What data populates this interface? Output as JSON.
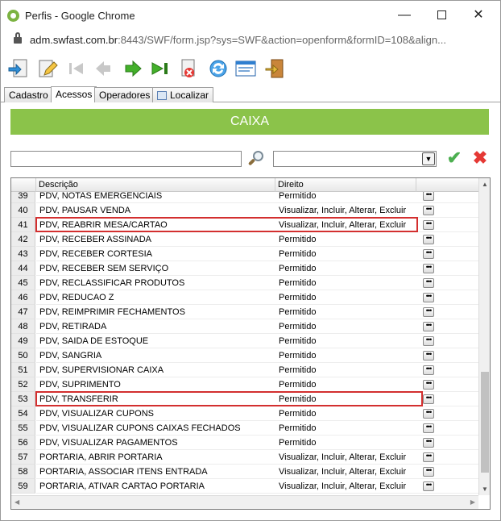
{
  "window": {
    "title": "Perfis - Google Chrome",
    "minimize": "—",
    "close": "✕"
  },
  "address": {
    "host": "adm.swfast.com.br",
    "rest": ":8443/SWF/form.jsp?sys=SWF&action=openform&formID=108&align..."
  },
  "tabs": [
    {
      "label": "Cadastro"
    },
    {
      "label": "Acessos"
    },
    {
      "label": "Operadores"
    },
    {
      "label": "Localizar"
    }
  ],
  "header": {
    "title": "CAIXA"
  },
  "filter": {
    "value": "",
    "select_value": ""
  },
  "grid": {
    "columns": {
      "descricao": "Descrição",
      "direito": "Direito"
    },
    "rows": [
      {
        "n": "39",
        "desc": "PDV, NOTAS EMERGENCIAIS",
        "dir": "Permitido"
      },
      {
        "n": "40",
        "desc": "PDV, PAUSAR VENDA",
        "dir": "Visualizar, Incluir, Alterar, Excluir"
      },
      {
        "n": "41",
        "desc": "PDV, REABRIR MESA/CARTAO",
        "dir": "Visualizar, Incluir, Alterar, Excluir"
      },
      {
        "n": "42",
        "desc": "PDV, RECEBER ASSINADA",
        "dir": "Permitido"
      },
      {
        "n": "43",
        "desc": "PDV, RECEBER CORTESIA",
        "dir": "Permitido"
      },
      {
        "n": "44",
        "desc": "PDV, RECEBER SEM SERVIÇO",
        "dir": "Permitido"
      },
      {
        "n": "45",
        "desc": "PDV, RECLASSIFICAR PRODUTOS",
        "dir": "Permitido"
      },
      {
        "n": "46",
        "desc": "PDV, REDUCAO Z",
        "dir": "Permitido"
      },
      {
        "n": "47",
        "desc": "PDV, REIMPRIMIR FECHAMENTOS",
        "dir": "Permitido"
      },
      {
        "n": "48",
        "desc": "PDV, RETIRADA",
        "dir": "Permitido"
      },
      {
        "n": "49",
        "desc": "PDV, SAIDA DE ESTOQUE",
        "dir": "Permitido"
      },
      {
        "n": "50",
        "desc": "PDV, SANGRIA",
        "dir": "Permitido"
      },
      {
        "n": "51",
        "desc": "PDV, SUPERVISIONAR CAIXA",
        "dir": "Permitido"
      },
      {
        "n": "52",
        "desc": "PDV, SUPRIMENTO",
        "dir": "Permitido"
      },
      {
        "n": "53",
        "desc": "PDV, TRANSFERIR",
        "dir": "Permitido"
      },
      {
        "n": "54",
        "desc": "PDV, VISUALIZAR CUPONS",
        "dir": "Permitido"
      },
      {
        "n": "55",
        "desc": "PDV, VISUALIZAR CUPONS CAIXAS FECHADOS",
        "dir": "Permitido"
      },
      {
        "n": "56",
        "desc": "PDV, VISUALIZAR PAGAMENTOS",
        "dir": "Permitido"
      },
      {
        "n": "57",
        "desc": "PORTARIA, ABRIR PORTARIA",
        "dir": "Visualizar, Incluir, Alterar, Excluir"
      },
      {
        "n": "58",
        "desc": "PORTARIA, ASSOCIAR ITENS ENTRADA",
        "dir": "Visualizar, Incluir, Alterar, Excluir"
      },
      {
        "n": "59",
        "desc": "PORTARIA, ATIVAR CARTAO PORTARIA",
        "dir": "Visualizar, Incluir, Alterar, Excluir"
      }
    ],
    "row_button": "•••"
  },
  "colors": {
    "accent_green": "#8bc34a",
    "highlight_red": "#d32f2f",
    "ok_green": "#4caf50",
    "cancel_red": "#e53935"
  }
}
